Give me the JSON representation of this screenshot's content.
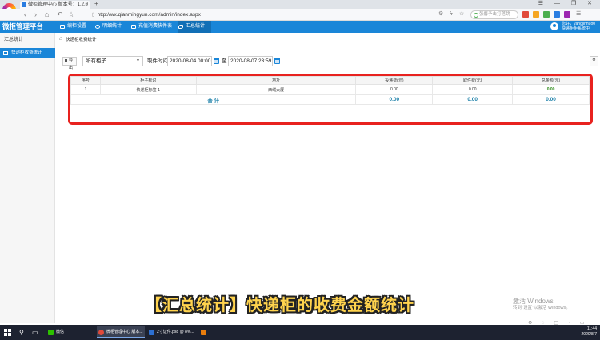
{
  "browser": {
    "tab_title": "微柜管理中心 版本号：1.2.0",
    "tab_close": "×",
    "new_tab": "+",
    "url": "http://wx.qianmingyun.com/admin/index.aspx",
    "search_placeholder": "张馨予击打落跳",
    "window_controls": "☰ — ❐ ✕",
    "nav_icons": [
      "back-icon",
      "forward-icon",
      "refresh-icon",
      "undo-icon",
      "star-icon"
    ]
  },
  "app": {
    "title": "微柜管理平台",
    "nav": [
      {
        "label": "编柜设置",
        "icon": "monitor-icon"
      },
      {
        "label": "明细统计",
        "icon": "gear-icon",
        "active": false
      },
      {
        "label": "充值消费快件表",
        "icon": "table-icon"
      },
      {
        "label": "汇总统计",
        "icon": "puzzle-icon",
        "active": true
      }
    ],
    "user": {
      "line1": "您好，yangjinhuo0",
      "line2": "快递柜柜系统中"
    }
  },
  "sidebar": {
    "heading": "汇总统计",
    "items": [
      {
        "label": "快递柜收费统计",
        "icon": "list-icon"
      }
    ]
  },
  "breadcrumb": "快递柜收费统计",
  "filters": {
    "export_label": "导出",
    "cabinet_value": "所有柜子",
    "time_label": "取件时间",
    "start": "2020-08-04 00:00",
    "to_label": "至",
    "end": "2020-08-07 23:59"
  },
  "table": {
    "headers": [
      "序号",
      "柜子标识",
      "地址",
      "投递费(元)",
      "取件费(元)",
      "总金额(元)"
    ],
    "rows": [
      [
        "1",
        "快递柜标签-1",
        "西绒大厦",
        "0.00",
        "0.00",
        "0.00"
      ]
    ],
    "total": {
      "label": "合 计",
      "delivery": "0.00",
      "pickup": "0.00",
      "amount": "0.00"
    }
  },
  "caption": "【汇总统计】快递柜的收费金额统计",
  "watermark": {
    "title": "激活 Windows",
    "sub": "转到\"设置\"以激活 Windows。"
  },
  "taskbar": {
    "apps": [
      {
        "label": "微信",
        "color": "#2dc100"
      },
      {
        "label": "微柜管理中心 版本...",
        "color": "#e14a3b",
        "active": true
      },
      {
        "label": "2寸证件.psd @ 8%...",
        "color": "#2c6fd1"
      },
      {
        "label": "",
        "color": "#e87d0d"
      }
    ],
    "time": "11:44",
    "date": "2020/8/7"
  },
  "colors": {
    "accent": "#1a86d8",
    "highlight": "#e8221f",
    "caption": "#ffd34d"
  }
}
